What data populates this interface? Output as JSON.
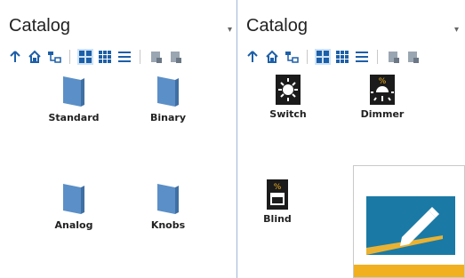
{
  "left_pane": {
    "title": "Catalog",
    "items": [
      {
        "label": "Standard",
        "icon": "folder-book-icon"
      },
      {
        "label": "Binary",
        "icon": "folder-book-icon"
      },
      {
        "label": "Analog",
        "icon": "folder-book-icon"
      },
      {
        "label": "Knobs",
        "icon": "folder-book-icon"
      }
    ]
  },
  "right_pane": {
    "title": "Catalog",
    "items": [
      {
        "label": "Switch",
        "icon": "switch-bulb-icon"
      },
      {
        "label": "Dimmer",
        "icon": "dimmer-bulb-icon"
      },
      {
        "label": "Blind",
        "icon": "blind-icon"
      }
    ]
  },
  "toolbar_icons": [
    "up-arrow-icon",
    "home-icon",
    "tree-view-icon",
    "large-icons-view-icon",
    "grid-view-icon",
    "list-view-icon",
    "import-icon",
    "export-icon"
  ],
  "colors": {
    "book": "#5b8fc7",
    "pane_border": "#9fb6d6",
    "tile_blue": "#1a7aa5",
    "tile_yellow": "#f0b020"
  }
}
